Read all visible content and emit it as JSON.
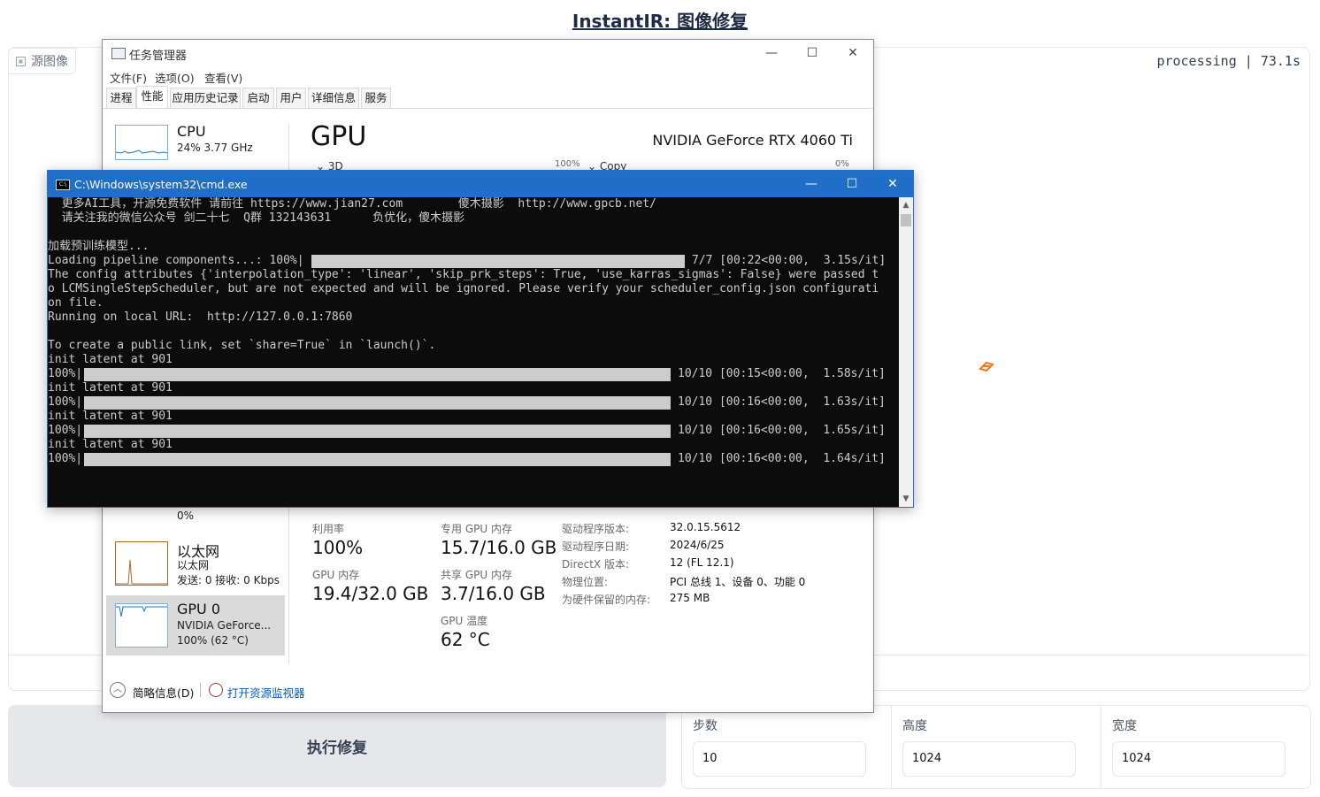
{
  "page": {
    "title": "InstantIR: 图像修复",
    "source_image_label": "源图像",
    "processing_status": "processing | 73.1s",
    "run_button": "执行修复",
    "params": [
      {
        "label": "步数",
        "value": "10"
      },
      {
        "label": "高度",
        "value": "1024"
      },
      {
        "label": "宽度",
        "value": "1024"
      }
    ],
    "accent_color": "#f97316"
  },
  "taskmgr": {
    "title": "任务管理器",
    "menu": [
      "文件(F)",
      "选项(O)",
      "查看(V)"
    ],
    "tabs": [
      "进程",
      "性能",
      "应用历史记录",
      "启动",
      "用户",
      "详细信息",
      "服务"
    ],
    "active_tab": "性能",
    "sidebar": {
      "cpu": {
        "name": "CPU",
        "sub": "24% 3.77 GHz"
      },
      "disk_partial": {
        "value": "0%"
      },
      "ethernet": {
        "name": "以太网",
        "sub1": "以太网",
        "sub2": "发送: 0 接收: 0 Kbps"
      },
      "gpu": {
        "name": "GPU 0",
        "sub1": "NVIDIA GeForce...",
        "sub2": "100% (62 °C)"
      }
    },
    "main": {
      "heading": "GPU",
      "model": "NVIDIA GeForce RTX 4060 Ti",
      "graph1_label": "3D",
      "graph1_pct": "100%",
      "graph2_label": "Copy",
      "graph2_pct": "0%",
      "stats": {
        "utilization_label": "利用率",
        "utilization": "100%",
        "dedicated_label": "专用 GPU 内存",
        "dedicated": "15.7/16.0 GB",
        "gpu_mem_label": "GPU 内存",
        "gpu_mem": "19.4/32.0 GB",
        "shared_label": "共享 GPU 内存",
        "shared": "3.7/16.0 GB",
        "temp_label": "GPU 温度",
        "temp": "62 °C"
      },
      "info": [
        {
          "k": "驱动程序版本:",
          "v": "32.0.15.5612"
        },
        {
          "k": "驱动程序日期:",
          "v": "2024/6/25"
        },
        {
          "k": "DirectX 版本:",
          "v": "12 (FL 12.1)"
        },
        {
          "k": "物理位置:",
          "v": "PCI 总线 1、设备 0、功能 0"
        },
        {
          "k": "为硬件保留的内存:",
          "v": "275 MB"
        }
      ]
    },
    "footer": {
      "brief": "简略信息(D)",
      "monitor": "打开资源监视器"
    }
  },
  "cmd": {
    "title": "C:\\Windows\\system32\\cmd.exe",
    "lines": [
      "  更多AI工具，开源免费软件 请前往 https://www.jian27.com        傻木摄影  http://www.gpcb.net/",
      "  请关注我的微信公众号 剑二十七  Q群 132143631      负优化，傻木摄影",
      "",
      "加载预训练模型...",
      "Loading pipeline components...: 100%|",
      "The config attributes {'interpolation_type': 'linear', 'skip_prk_steps': True, 'use_karras_sigmas': False} were passed t",
      "o LCMSingleStepScheduler, but are not expected and will be ignored. Please verify your scheduler_config.json configurati",
      "on file.",
      "Running on local URL:  http://127.0.0.1:7860",
      "",
      "To create a public link, set `share=True` in `launch()`.",
      "init latent at 901",
      "100%|",
      "init latent at 901",
      "100%|",
      "init latent at 901",
      "100%|",
      "init latent at 901",
      "100%|"
    ],
    "bar_suffixes": [
      "7/7 [00:22<00:00,  3.15s/it]",
      "10/10 [00:15<00:00,  1.58s/it]",
      "10/10 [00:16<00:00,  1.63s/it]",
      "10/10 [00:16<00:00,  1.65s/it]",
      "10/10 [00:16<00:00,  1.64s/it]"
    ],
    "progress": [
      1.0,
      1.0,
      1.0,
      1.0,
      1.0
    ]
  }
}
